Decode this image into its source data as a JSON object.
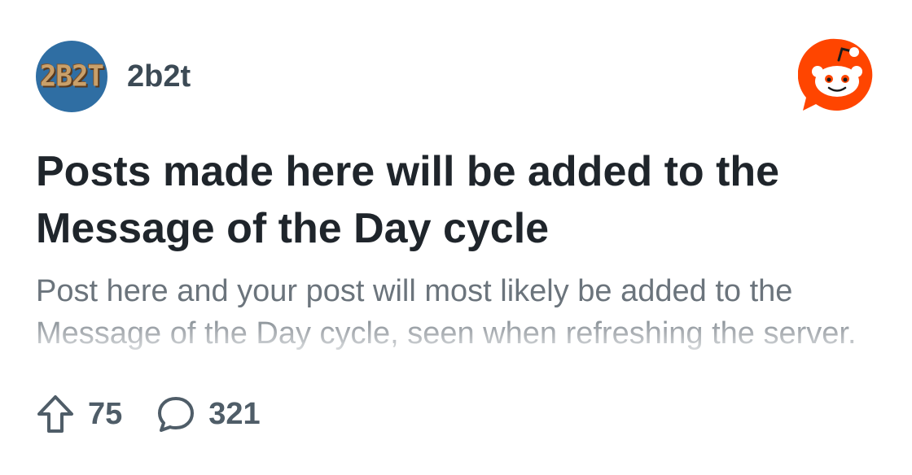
{
  "subreddit": {
    "name": "2b2t",
    "avatar_text": "2B2T"
  },
  "post": {
    "title": "Posts made here will be added to the Message of the Day cycle",
    "body": "Post here and your post will most likely be added to the Message of the Day cycle, seen when refreshing the server."
  },
  "stats": {
    "upvotes": "75",
    "comments": "321"
  },
  "colors": {
    "reddit_orange": "#ff4500",
    "text_dark": "#1f252b",
    "text_muted": "#6b747c",
    "stat_gray": "#4f5d68",
    "avatar_bg": "#2f6ea3"
  },
  "icons": {
    "upvote": "upvote-arrow-icon",
    "comment": "comment-bubble-icon",
    "brand": "reddit-logo-icon"
  }
}
